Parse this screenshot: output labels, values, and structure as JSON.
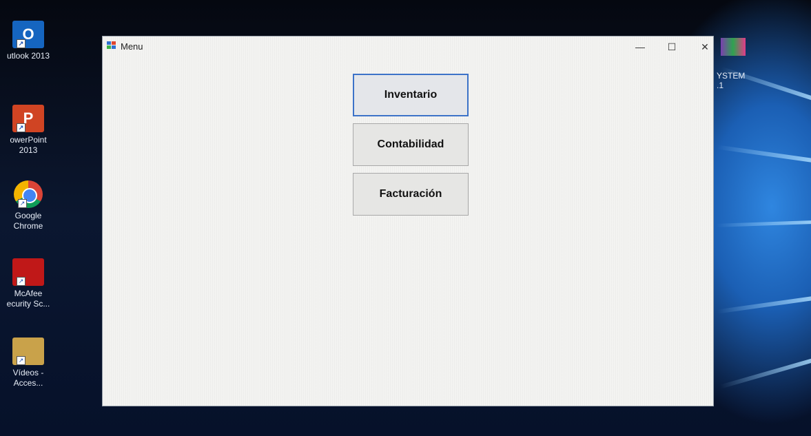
{
  "desktop": {
    "icons": [
      {
        "label": "utlook 2013",
        "glyph": "O",
        "icon": "outlook-icon"
      },
      {
        "label": "owerPoint\n2013",
        "glyph": "P",
        "icon": "powerpoint-icon"
      },
      {
        "label": "Google\nChrome",
        "glyph": "",
        "icon": "chrome-icon"
      },
      {
        "label": "McAfee\necurity Sc...",
        "glyph": "",
        "icon": "mcafee-icon"
      },
      {
        "label": "Vídeos -\nAcces...",
        "glyph": "",
        "icon": "video-folder-icon"
      }
    ],
    "right_icon_label": "YSTEM\n.1"
  },
  "window": {
    "title": "Menu",
    "controls": {
      "minimize": "—",
      "maximize": "☐",
      "close": "✕"
    },
    "buttons": [
      {
        "label": "Inventario"
      },
      {
        "label": "Contabilidad"
      },
      {
        "label": "Facturación"
      }
    ]
  },
  "colors": {
    "focus_border": "#3c72c8",
    "window_bg": "#f3f3f1",
    "button_bg": "#e6e6e4"
  }
}
